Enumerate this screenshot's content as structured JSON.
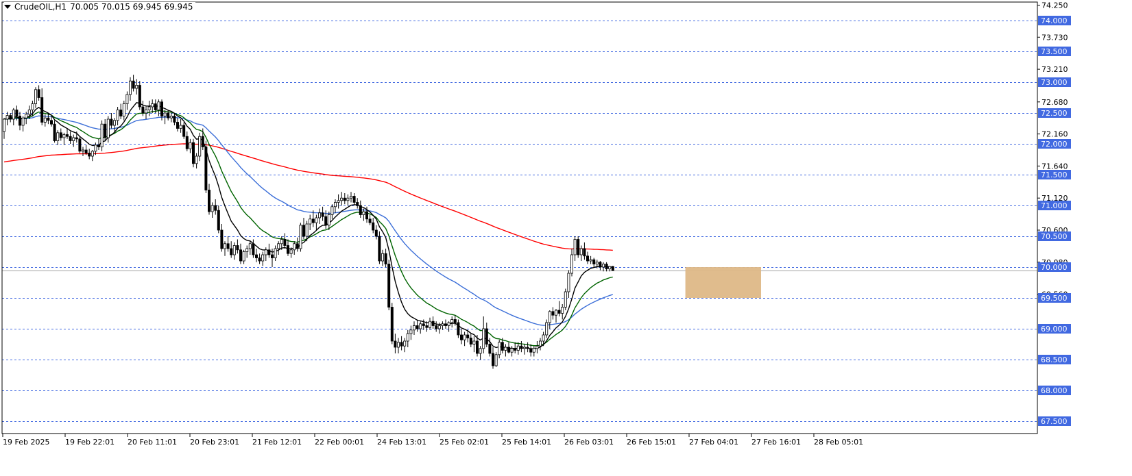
{
  "header": {
    "symbol_tf": "CrudeOIL,H1",
    "ohlc": "70.005 70.015 69.945 69.945"
  },
  "chart_data": {
    "type": "candlestick",
    "symbol": "CrudeOIL",
    "timeframe": "H1",
    "ylim": [
      67.3,
      74.3
    ],
    "x_tick_labels": [
      "19 Feb 2025",
      "19 Feb 22:01",
      "20 Feb 11:01",
      "20 Feb 23:01",
      "21 Feb 12:01",
      "22 Feb 00:01",
      "24 Feb 13:01",
      "25 Feb 02:01",
      "25 Feb 14:01",
      "26 Feb 03:01",
      "26 Feb 15:01",
      "27 Feb 04:01",
      "27 Feb 16:01",
      "28 Feb 05:01"
    ],
    "y_tick_labels": [
      "74.250",
      "73.730",
      "73.210",
      "72.680",
      "72.160",
      "71.640",
      "71.120",
      "70.600",
      "70.080",
      "69.560"
    ],
    "levels": [
      74.0,
      73.5,
      73.0,
      72.5,
      72.0,
      71.5,
      71.0,
      70.5,
      70.0,
      69.5,
      69.0,
      68.5,
      68.0,
      67.5
    ],
    "level_labels": [
      "74.000",
      "73.500",
      "73.000",
      "72.500",
      "72.000",
      "71.500",
      "71.000",
      "70.500",
      "70.000",
      "69.500",
      "69.000",
      "68.500",
      "68.000",
      "67.500"
    ],
    "current_price": 69.945,
    "zone": {
      "from_bar": 216,
      "to_bar": 240,
      "low": 69.5,
      "high": 70.0,
      "color": "#deb887"
    },
    "colors": {
      "grid": "#4169e1",
      "ma_fast": "#000000",
      "ma_mid": "#006400",
      "ma_slow": "#3c6fd8",
      "ma_long": "#ff0000",
      "candle": "#000000"
    },
    "candles": [
      [
        72.2,
        72.42,
        72.08,
        72.4
      ],
      [
        72.4,
        72.52,
        72.3,
        72.46
      ],
      [
        72.46,
        72.5,
        72.35,
        72.4
      ],
      [
        72.4,
        72.58,
        72.3,
        72.55
      ],
      [
        72.55,
        72.62,
        72.38,
        72.45
      ],
      [
        72.45,
        72.52,
        72.22,
        72.3
      ],
      [
        72.3,
        72.45,
        72.2,
        72.42
      ],
      [
        72.42,
        72.52,
        72.32,
        72.48
      ],
      [
        72.48,
        72.62,
        72.4,
        72.55
      ],
      [
        72.55,
        72.7,
        72.45,
        72.65
      ],
      [
        72.65,
        72.92,
        72.58,
        72.88
      ],
      [
        72.88,
        72.95,
        72.7,
        72.75
      ],
      [
        72.75,
        72.9,
        72.3,
        72.35
      ],
      [
        72.35,
        72.48,
        72.28,
        72.42
      ],
      [
        72.42,
        72.5,
        72.32,
        72.38
      ],
      [
        72.38,
        72.45,
        72.28,
        72.32
      ],
      [
        72.32,
        72.38,
        72.02,
        72.05
      ],
      [
        72.05,
        72.22,
        71.98,
        72.18
      ],
      [
        72.18,
        72.25,
        72.05,
        72.1
      ],
      [
        72.1,
        72.18,
        71.98,
        72.15
      ],
      [
        72.15,
        72.25,
        72.08,
        72.12
      ],
      [
        72.12,
        72.2,
        72.0,
        72.05
      ],
      [
        72.05,
        72.15,
        71.95,
        72.1
      ],
      [
        72.1,
        72.2,
        72.02,
        72.08
      ],
      [
        72.08,
        72.12,
        71.85,
        71.88
      ],
      [
        71.88,
        71.95,
        71.8,
        71.9
      ],
      [
        71.9,
        71.98,
        71.82,
        71.85
      ],
      [
        71.85,
        71.92,
        71.75,
        71.8
      ],
      [
        71.8,
        71.9,
        71.72,
        71.88
      ],
      [
        71.88,
        72.02,
        71.82,
        71.98
      ],
      [
        71.98,
        72.08,
        71.9,
        71.95
      ],
      [
        71.95,
        72.38,
        71.88,
        72.32
      ],
      [
        72.32,
        72.4,
        72.05,
        72.1
      ],
      [
        72.1,
        72.45,
        72.02,
        72.4
      ],
      [
        72.4,
        72.5,
        72.25,
        72.3
      ],
      [
        72.3,
        72.42,
        72.2,
        72.38
      ],
      [
        72.38,
        72.6,
        72.3,
        72.55
      ],
      [
        72.55,
        72.65,
        72.4,
        72.45
      ],
      [
        72.45,
        72.7,
        72.38,
        72.65
      ],
      [
        72.65,
        72.85,
        72.55,
        72.8
      ],
      [
        72.8,
        73.08,
        72.7,
        73.02
      ],
      [
        73.02,
        73.12,
        72.85,
        72.9
      ],
      [
        72.9,
        73.05,
        72.8,
        72.95
      ],
      [
        72.95,
        73.02,
        72.55,
        72.6
      ],
      [
        72.6,
        72.7,
        72.45,
        72.5
      ],
      [
        72.5,
        72.62,
        72.4,
        72.55
      ],
      [
        72.55,
        72.7,
        72.45,
        72.6
      ],
      [
        72.6,
        72.72,
        72.5,
        72.65
      ],
      [
        72.65,
        72.72,
        72.5,
        72.55
      ],
      [
        72.55,
        72.72,
        72.45,
        72.68
      ],
      [
        72.68,
        72.72,
        72.38,
        72.45
      ],
      [
        72.45,
        72.55,
        72.32,
        72.5
      ],
      [
        72.5,
        72.55,
        72.38,
        72.42
      ],
      [
        72.42,
        72.5,
        72.35,
        72.45
      ],
      [
        72.45,
        72.5,
        72.3,
        72.35
      ],
      [
        72.35,
        72.42,
        72.2,
        72.25
      ],
      [
        72.25,
        72.4,
        72.18,
        72.3
      ],
      [
        72.3,
        72.35,
        72.08,
        72.12
      ],
      [
        72.12,
        72.2,
        71.88,
        71.92
      ],
      [
        71.92,
        72.08,
        71.85,
        72.02
      ],
      [
        72.02,
        72.08,
        71.62,
        71.68
      ],
      [
        71.68,
        71.85,
        71.6,
        71.8
      ],
      [
        71.8,
        72.18,
        71.72,
        72.12
      ],
      [
        72.12,
        72.25,
        71.9,
        71.95
      ],
      [
        71.95,
        72.05,
        71.2,
        71.25
      ],
      [
        71.25,
        71.35,
        70.85,
        70.9
      ],
      [
        70.9,
        71.05,
        70.8,
        71.0
      ],
      [
        71.0,
        71.1,
        70.85,
        70.92
      ],
      [
        70.92,
        71.0,
        70.55,
        70.6
      ],
      [
        70.6,
        70.7,
        70.25,
        70.3
      ],
      [
        70.3,
        70.42,
        70.18,
        70.38
      ],
      [
        70.38,
        70.5,
        70.25,
        70.3
      ],
      [
        70.3,
        70.42,
        70.15,
        70.2
      ],
      [
        70.2,
        70.4,
        70.12,
        70.35
      ],
      [
        70.35,
        70.45,
        70.22,
        70.28
      ],
      [
        70.28,
        70.38,
        70.05,
        70.1
      ],
      [
        70.1,
        70.28,
        70.05,
        70.25
      ],
      [
        70.25,
        70.35,
        70.15,
        70.3
      ],
      [
        70.3,
        70.42,
        70.2,
        70.38
      ],
      [
        70.38,
        70.45,
        70.15,
        70.2
      ],
      [
        70.2,
        70.3,
        70.08,
        70.15
      ],
      [
        70.15,
        70.22,
        70.05,
        70.1
      ],
      [
        70.1,
        70.25,
        70.02,
        70.2
      ],
      [
        70.2,
        70.32,
        70.1,
        70.28
      ],
      [
        70.28,
        70.38,
        70.15,
        70.2
      ],
      [
        70.2,
        70.3,
        70.0,
        70.15
      ],
      [
        70.15,
        70.35,
        70.1,
        70.3
      ],
      [
        70.3,
        70.42,
        70.2,
        70.38
      ],
      [
        70.38,
        70.5,
        70.28,
        70.45
      ],
      [
        70.45,
        70.55,
        70.3,
        70.35
      ],
      [
        70.35,
        70.45,
        70.18,
        70.22
      ],
      [
        70.22,
        70.32,
        70.15,
        70.28
      ],
      [
        70.28,
        70.42,
        70.2,
        70.38
      ],
      [
        70.38,
        70.48,
        70.25,
        70.3
      ],
      [
        70.3,
        70.72,
        70.25,
        70.68
      ],
      [
        70.68,
        70.8,
        70.45,
        70.5
      ],
      [
        70.5,
        70.75,
        70.42,
        70.7
      ],
      [
        70.7,
        70.85,
        70.6,
        70.78
      ],
      [
        70.78,
        70.92,
        70.65,
        70.72
      ],
      [
        70.72,
        70.85,
        70.6,
        70.8
      ],
      [
        70.8,
        70.95,
        70.7,
        70.88
      ],
      [
        70.88,
        70.98,
        70.75,
        70.82
      ],
      [
        70.82,
        70.92,
        70.62,
        70.68
      ],
      [
        70.68,
        70.9,
        70.6,
        70.85
      ],
      [
        70.85,
        71.02,
        70.78,
        70.98
      ],
      [
        70.98,
        71.1,
        70.88,
        71.05
      ],
      [
        71.05,
        71.18,
        70.95,
        71.08
      ],
      [
        71.08,
        71.22,
        71.0,
        71.12
      ],
      [
        71.12,
        71.2,
        71.02,
        71.08
      ],
      [
        71.08,
        71.18,
        71.0,
        71.12
      ],
      [
        71.12,
        71.22,
        71.05,
        71.15
      ],
      [
        71.15,
        71.2,
        71.0,
        71.05
      ],
      [
        71.05,
        71.12,
        70.95,
        71.0
      ],
      [
        71.0,
        71.08,
        70.8,
        70.85
      ],
      [
        70.85,
        70.95,
        70.75,
        70.9
      ],
      [
        70.9,
        70.98,
        70.72,
        70.78
      ],
      [
        70.78,
        70.85,
        70.68,
        70.72
      ],
      [
        70.72,
        70.8,
        70.55,
        70.6
      ],
      [
        70.6,
        70.68,
        70.45,
        70.5
      ],
      [
        70.5,
        70.58,
        70.05,
        70.1
      ],
      [
        70.1,
        70.28,
        70.02,
        70.22
      ],
      [
        70.22,
        70.3,
        70.0,
        70.05
      ],
      [
        70.05,
        70.12,
        69.3,
        69.35
      ],
      [
        69.35,
        69.42,
        68.75,
        68.8
      ],
      [
        68.8,
        68.92,
        68.6,
        68.7
      ],
      [
        68.7,
        68.85,
        68.6,
        68.78
      ],
      [
        68.78,
        68.88,
        68.65,
        68.72
      ],
      [
        68.72,
        68.85,
        68.62,
        68.8
      ],
      [
        68.8,
        68.98,
        68.7,
        68.92
      ],
      [
        68.92,
        69.05,
        68.82,
        68.98
      ],
      [
        68.98,
        69.12,
        68.9,
        69.05
      ],
      [
        69.05,
        69.15,
        68.95,
        69.0
      ],
      [
        69.0,
        69.12,
        68.92,
        69.08
      ],
      [
        69.08,
        69.15,
        68.98,
        69.05
      ],
      [
        69.05,
        69.12,
        68.95,
        69.02
      ],
      [
        69.02,
        69.18,
        68.98,
        69.12
      ],
      [
        69.12,
        69.2,
        69.0,
        69.05
      ],
      [
        69.05,
        69.12,
        68.95,
        69.0
      ],
      [
        69.0,
        69.1,
        68.92,
        69.05
      ],
      [
        69.05,
        69.12,
        68.98,
        69.08
      ],
      [
        69.08,
        69.15,
        69.0,
        69.05
      ],
      [
        69.05,
        69.12,
        68.95,
        69.1
      ],
      [
        69.1,
        69.2,
        69.02,
        69.15
      ],
      [
        69.15,
        69.22,
        69.05,
        69.1
      ],
      [
        69.1,
        69.15,
        68.85,
        68.9
      ],
      [
        68.9,
        69.0,
        68.75,
        68.82
      ],
      [
        68.82,
        68.95,
        68.72,
        68.9
      ],
      [
        68.9,
        68.98,
        68.78,
        68.85
      ],
      [
        68.85,
        68.92,
        68.7,
        68.75
      ],
      [
        68.75,
        68.88,
        68.62,
        68.8
      ],
      [
        68.8,
        68.9,
        68.55,
        68.6
      ],
      [
        68.6,
        68.72,
        68.5,
        68.68
      ],
      [
        68.68,
        69.2,
        68.6,
        69.0
      ],
      [
        69.0,
        69.1,
        68.7,
        68.75
      ],
      [
        68.75,
        68.85,
        68.55,
        68.6
      ],
      [
        68.6,
        68.7,
        68.35,
        68.4
      ],
      [
        68.4,
        68.62,
        68.38,
        68.58
      ],
      [
        68.58,
        68.82,
        68.52,
        68.78
      ],
      [
        68.78,
        68.85,
        68.6,
        68.65
      ],
      [
        68.65,
        68.75,
        68.55,
        68.7
      ],
      [
        68.7,
        68.78,
        68.6,
        68.62
      ],
      [
        68.62,
        68.72,
        68.55,
        68.68
      ],
      [
        68.68,
        68.78,
        68.6,
        68.65
      ],
      [
        68.65,
        68.78,
        68.58,
        68.72
      ],
      [
        68.72,
        68.8,
        68.62,
        68.68
      ],
      [
        68.68,
        68.75,
        68.58,
        68.7
      ],
      [
        68.7,
        68.78,
        68.62,
        68.68
      ],
      [
        68.68,
        68.75,
        68.55,
        68.62
      ],
      [
        68.62,
        68.72,
        68.55,
        68.68
      ],
      [
        68.68,
        68.8,
        68.6,
        68.72
      ],
      [
        68.72,
        68.85,
        68.65,
        68.8
      ],
      [
        68.8,
        68.95,
        68.72,
        68.9
      ],
      [
        68.9,
        69.15,
        68.85,
        69.1
      ],
      [
        69.1,
        69.3,
        69.0,
        69.28
      ],
      [
        69.28,
        69.35,
        69.15,
        69.22
      ],
      [
        69.22,
        69.32,
        69.1,
        69.3
      ],
      [
        69.3,
        69.45,
        69.2,
        69.25
      ],
      [
        69.25,
        69.4,
        69.15,
        69.35
      ],
      [
        69.35,
        69.65,
        69.3,
        69.6
      ],
      [
        69.6,
        69.95,
        69.5,
        69.9
      ],
      [
        69.9,
        70.3,
        69.85,
        70.2
      ],
      [
        70.2,
        70.5,
        70.1,
        70.45
      ],
      [
        70.45,
        70.5,
        70.15,
        70.2
      ],
      [
        70.2,
        70.35,
        70.1,
        70.3
      ],
      [
        70.3,
        70.4,
        70.12,
        70.18
      ],
      [
        70.18,
        70.25,
        70.05,
        70.1
      ],
      [
        70.1,
        70.18,
        70.05,
        70.12
      ],
      [
        70.12,
        70.15,
        70.0,
        70.05
      ],
      [
        70.05,
        70.12,
        69.98,
        70.08
      ],
      [
        70.08,
        70.1,
        69.95,
        70.0
      ],
      [
        70.0,
        70.08,
        69.93,
        70.05
      ],
      [
        70.05,
        70.08,
        69.93,
        69.97
      ],
      [
        69.97,
        70.02,
        69.93,
        70.01
      ],
      [
        70.01,
        70.02,
        69.94,
        69.945
      ]
    ]
  }
}
